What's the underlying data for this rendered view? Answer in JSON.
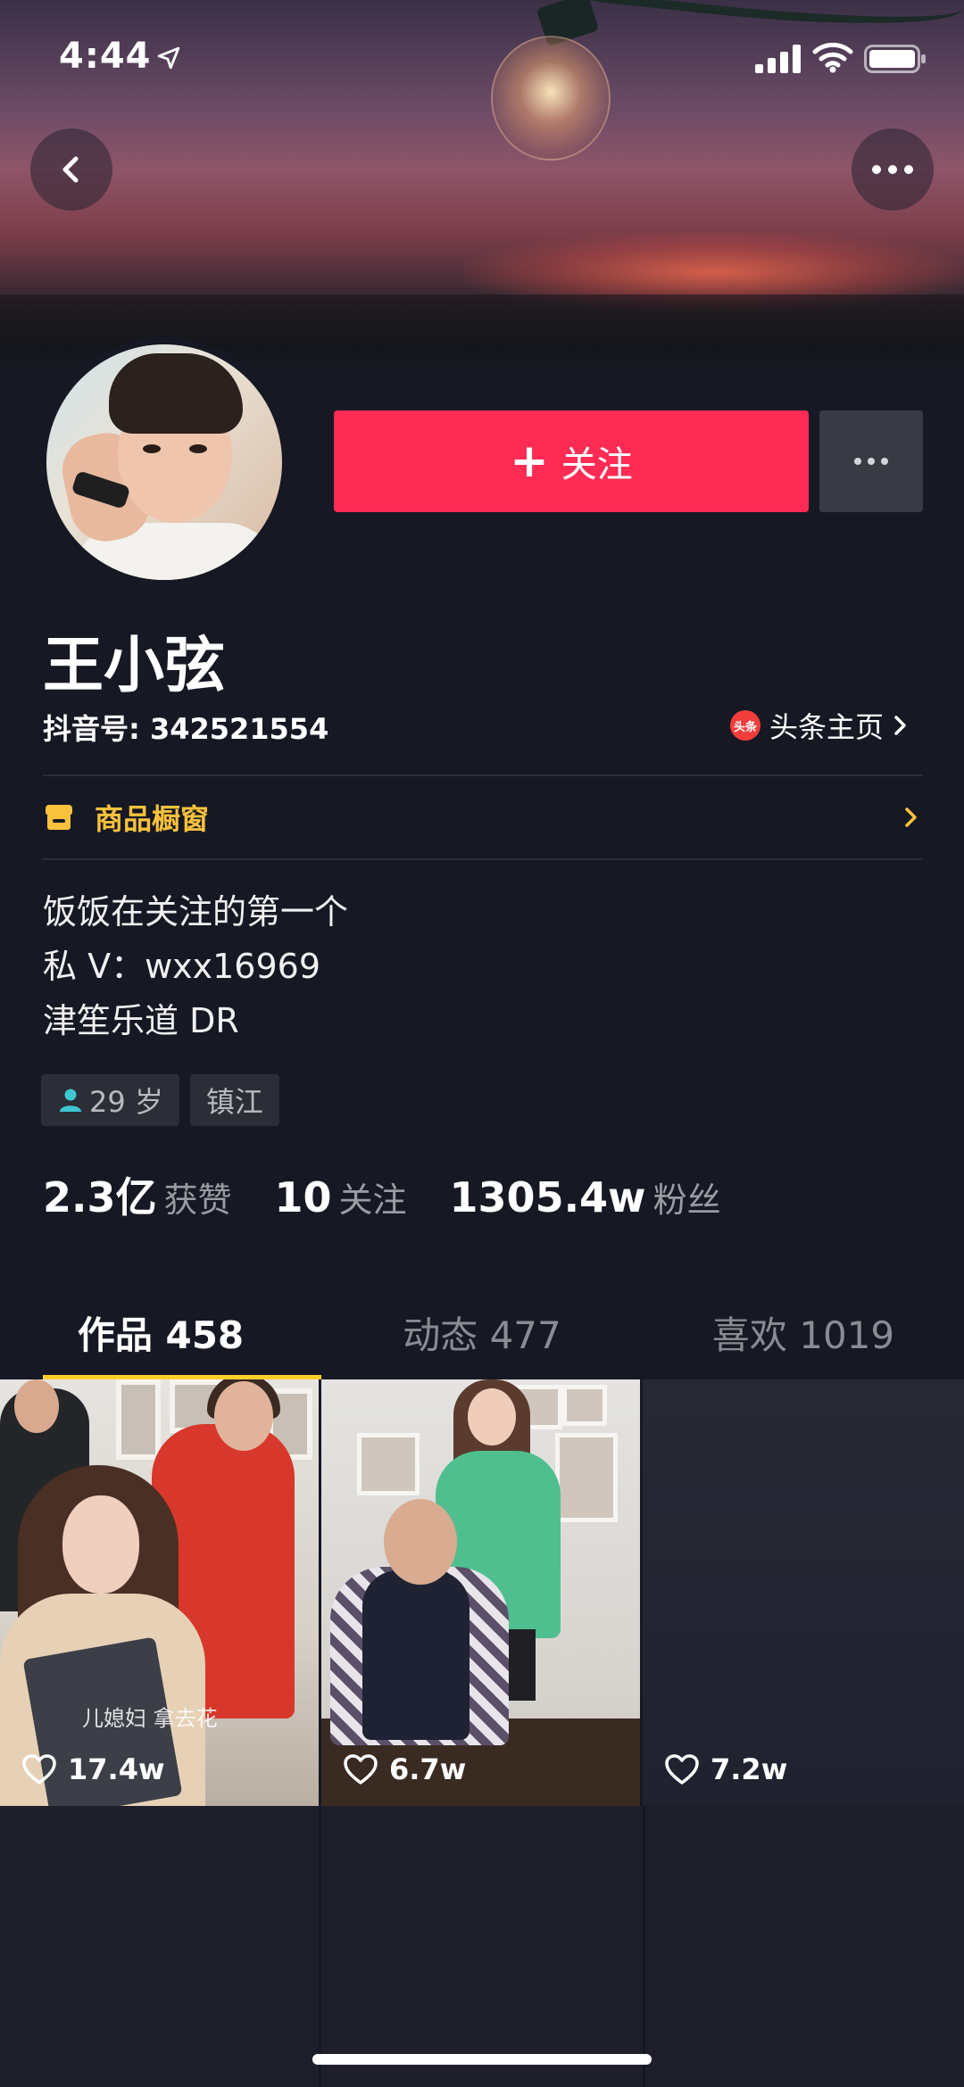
{
  "status_bar": {
    "time": "4:44"
  },
  "profile": {
    "name": "王小弦",
    "douyin_id": "抖音号: 342521554",
    "toutiao_badge": "头条",
    "toutiao_label": "头条主页",
    "follow_label": "关注",
    "follow_plus": "+",
    "shop_label": "商品橱窗",
    "bio": [
      "饭饭在关注的第一个",
      "私 V：wxx16969",
      "津笙乐道 DR"
    ],
    "tags": {
      "age": "29 岁",
      "city": "镇江"
    },
    "stats": [
      {
        "value": "2.3亿",
        "label": "获赞"
      },
      {
        "value": "10",
        "label": "关注"
      },
      {
        "value": "1305.4w",
        "label": "粉丝"
      }
    ]
  },
  "tabs": [
    {
      "label": "作品 458",
      "active": true
    },
    {
      "label": "动态 477",
      "active": false
    },
    {
      "label": "喜欢 1019",
      "active": false
    }
  ],
  "videos": [
    {
      "likes": "17.4w",
      "caption": "儿媳妇 拿去花"
    },
    {
      "likes": "6.7w"
    },
    {
      "likes": "7.2w"
    }
  ],
  "colors": {
    "accent": "#fe2c55",
    "tab_indicator": "#fcce2a",
    "shop": "#f9c23c",
    "background": "#161823"
  }
}
